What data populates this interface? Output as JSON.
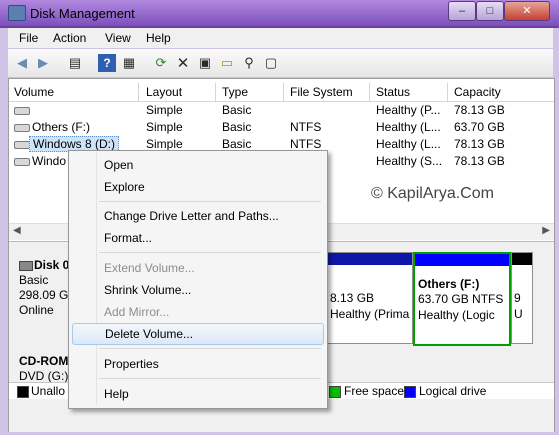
{
  "window": {
    "title": "Disk Management"
  },
  "caption": {
    "minimize": "–",
    "maximize": "□",
    "close": "✕"
  },
  "menubar": [
    {
      "label": "File"
    },
    {
      "label": "Action"
    },
    {
      "label": "View"
    },
    {
      "label": "Help"
    }
  ],
  "toolbar": {
    "icons": [
      "back-icon",
      "forward-icon",
      "show-hide-console-tree-icon",
      "help-icon",
      "properties-icon",
      "refresh-icon",
      "delete-icon",
      "settings-icon",
      "open-folder-icon",
      "search-icon",
      "window-icon"
    ]
  },
  "volume_list": {
    "columns": [
      "Volume",
      "Layout",
      "Type",
      "File System",
      "Status",
      "Capacity"
    ],
    "rows": [
      {
        "volume": "",
        "layout": "Simple",
        "type": "Basic",
        "fs": "",
        "status": "Healthy (P...",
        "capacity": "78.13 GB"
      },
      {
        "volume": "Others (F:)",
        "layout": "Simple",
        "type": "Basic",
        "fs": "NTFS",
        "status": "Healthy (L...",
        "capacity": "63.70 GB"
      },
      {
        "volume": "Windows 8 (D:)",
        "layout": "Simple",
        "type": "Basic",
        "fs": "NTFS",
        "status": "Healthy (L...",
        "capacity": "78.13 GB"
      },
      {
        "volume": "Windo",
        "layout": "",
        "type": "",
        "fs": "",
        "status": "Healthy (S...",
        "capacity": "78.13 GB"
      }
    ]
  },
  "watermark": "© KapilArya.Com",
  "disks": [
    {
      "name": "Disk 0",
      "type": "Basic",
      "size": "298.09 GB",
      "state": "Online"
    },
    {
      "name": "CD-ROM 0",
      "type": "DVD (G:)",
      "size": "",
      "state": ""
    }
  ],
  "partitions": [
    {
      "title": "",
      "size": "8.13 GB",
      "status": "Healthy (Primar"
    },
    {
      "title": "Others  (F:)",
      "size": "63.70 GB NTFS",
      "status": "Healthy (Logic"
    },
    {
      "title": "",
      "size": "9",
      "status": "U"
    }
  ],
  "legend": [
    {
      "label": "Unallo",
      "color": "#000000"
    },
    {
      "label": "Free space",
      "color": "#00c000"
    },
    {
      "label": "Logical drive",
      "color": "#0000ff"
    }
  ],
  "context_menu": {
    "items": [
      {
        "label": "Open"
      },
      {
        "label": "Explore"
      },
      {
        "label": "Change Drive Letter and Paths..."
      },
      {
        "label": "Format..."
      },
      {
        "label": "Extend Volume..."
      },
      {
        "label": "Shrink Volume..."
      },
      {
        "label": "Add Mirror..."
      },
      {
        "label": "Delete Volume..."
      },
      {
        "label": "Properties"
      },
      {
        "label": "Help"
      }
    ]
  },
  "colors": {
    "primary_bar": "#0f17a8",
    "logical_bar": "#0000ff",
    "free_border": "#00a000",
    "selection": "#cde3f7"
  }
}
